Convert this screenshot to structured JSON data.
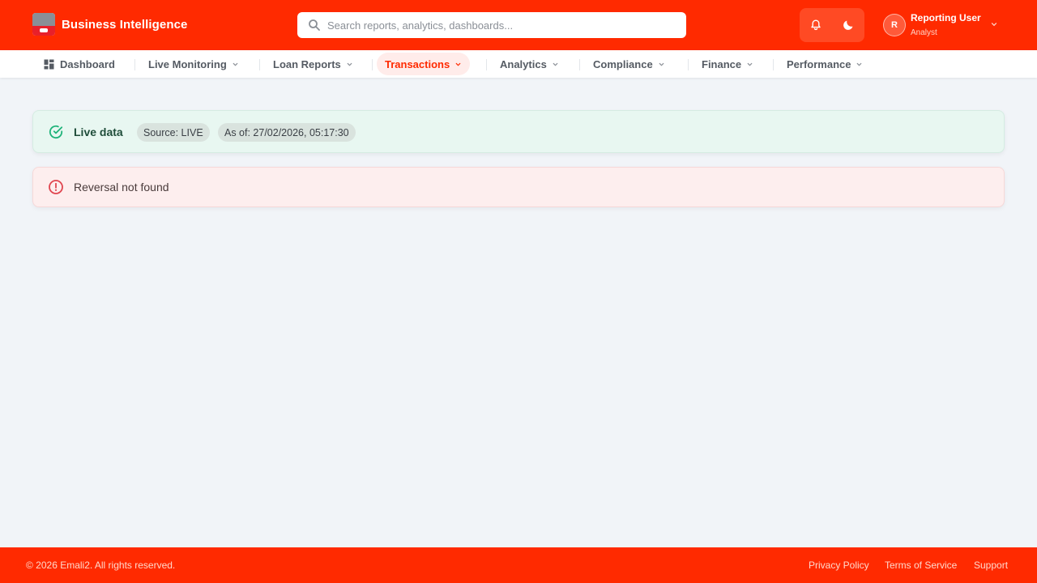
{
  "header": {
    "brand_title": "Business Intelligence",
    "search_placeholder": "Search reports, analytics, dashboards...",
    "user": {
      "initial": "R",
      "name": "Reporting User",
      "role": "Analyst"
    }
  },
  "nav": {
    "items": [
      {
        "label": "Dashboard"
      },
      {
        "label": "Live Monitoring"
      },
      {
        "label": "Loan Reports"
      },
      {
        "label": "Transactions"
      },
      {
        "label": "Analytics"
      },
      {
        "label": "Compliance"
      },
      {
        "label": "Finance"
      },
      {
        "label": "Performance"
      }
    ],
    "active": "Transactions"
  },
  "status": {
    "live_title": "Live data",
    "source": "Source: LIVE",
    "as_of": "As of: 27/02/2026, 05:17:30"
  },
  "error": {
    "message": "Reversal not found"
  },
  "footer": {
    "copyright": "© 2026 Emali2. All rights reserved.",
    "links": [
      "Privacy Policy",
      "Terms of Service",
      "Support"
    ]
  },
  "colors": {
    "brand": "#ff2a00",
    "success": "#1fb37a",
    "error": "#e0454f"
  }
}
